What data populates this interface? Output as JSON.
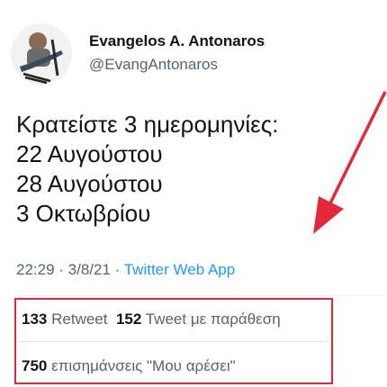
{
  "author": {
    "display_name": "Evangelos A. Antonaros",
    "handle": "@EvangAntonaros"
  },
  "tweet": {
    "lines": [
      "Κρατείστε 3 ημερομηνίες:",
      "22 Αυγούστου",
      "28 Αυγούστου",
      "3 Οκτωβρίου"
    ]
  },
  "meta": {
    "time": "22:29",
    "separator": " · ",
    "date": "3/8/21",
    "source": "Twitter Web App"
  },
  "stats": {
    "retweets_count": "133",
    "retweets_label": "Retweet",
    "quotes_count": "152",
    "quotes_label": "Tweet με παράθεση",
    "likes_count": "750",
    "likes_label": "επισημάνσεις \"Μου αρέσει\""
  },
  "colors": {
    "annotation_red": "#e3283a",
    "link_blue": "#1d9bf0",
    "muted_text": "#536471"
  }
}
